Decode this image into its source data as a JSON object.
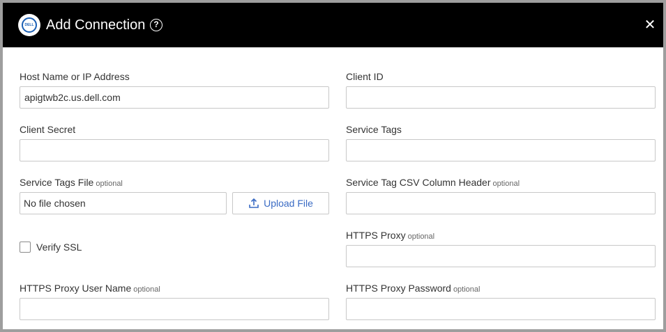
{
  "dialog": {
    "title": "Add Connection",
    "help_icon": "help-circle-icon",
    "close_icon": "close-icon",
    "logo_text": "DELL"
  },
  "fields": {
    "host": {
      "label": "Host Name or IP Address",
      "value": "apigtwb2c.us.dell.com"
    },
    "client_id": {
      "label": "Client ID",
      "value": ""
    },
    "client_secret": {
      "label": "Client Secret",
      "value": ""
    },
    "service_tags": {
      "label": "Service Tags",
      "value": ""
    },
    "service_tags_file": {
      "label": "Service Tags File",
      "optional": "optional",
      "file_status": "No file chosen",
      "upload_label": "Upload File"
    },
    "csv_header": {
      "label": "Service Tag CSV Column Header",
      "optional": "optional",
      "value": ""
    },
    "verify_ssl": {
      "label": "Verify SSL",
      "checked": false
    },
    "https_proxy": {
      "label": "HTTPS Proxy",
      "optional": "optional",
      "value": ""
    },
    "proxy_user": {
      "label": "HTTPS Proxy User Name",
      "optional": "optional",
      "value": ""
    },
    "proxy_password": {
      "label": "HTTPS Proxy Password",
      "optional": "optional",
      "value": ""
    }
  }
}
